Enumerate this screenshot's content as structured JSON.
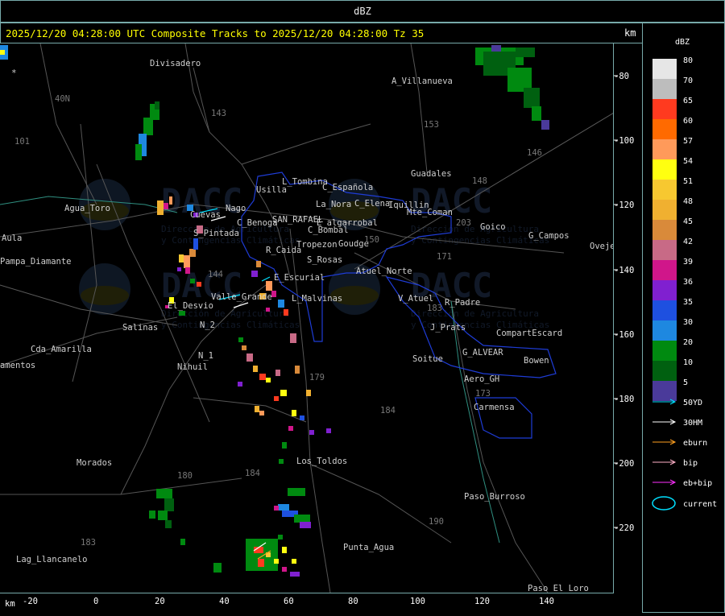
{
  "window": {
    "title": "dBZ"
  },
  "header": {
    "title": "2025/12/20 04:28:00 UTC Composite Tracks to 2025/12/20 04:28:00 Tz 35",
    "unit": "km"
  },
  "legend": {
    "title": "dBZ",
    "colors": [
      {
        "label": "80",
        "color": "#e6e6e6"
      },
      {
        "label": "70",
        "color": "#bdbdbd"
      },
      {
        "label": "65",
        "color": "#ff3a1f"
      },
      {
        "label": "60",
        "color": "#ff6a00"
      },
      {
        "label": "57",
        "color": "#ff9a5a"
      },
      {
        "label": "54",
        "color": "#ffff10"
      },
      {
        "label": "51",
        "color": "#f7c830"
      },
      {
        "label": "48",
        "color": "#f0b030"
      },
      {
        "label": "45",
        "color": "#d98a3a"
      },
      {
        "label": "42",
        "color": "#c86a86"
      },
      {
        "label": "39",
        "color": "#d0168a"
      },
      {
        "label": "36",
        "color": "#8020d0"
      },
      {
        "label": "35",
        "color": "#1e50e0"
      },
      {
        "label": "30",
        "color": "#1e88e0"
      },
      {
        "label": "20",
        "color": "#008a10"
      },
      {
        "label": "10",
        "color": "#006010"
      },
      {
        "label": "5",
        "color": "#4a3a9a"
      }
    ],
    "tracks": [
      {
        "label": "50YD",
        "color": "#00e0ff"
      },
      {
        "label": "30HM",
        "color": "#ffffff"
      },
      {
        "label": "eburn",
        "color": "#ffa020"
      },
      {
        "label": "bip",
        "color": "#ffb0c8"
      },
      {
        "label": "eb+bip",
        "color": "#ff30ff"
      }
    ],
    "current_label": "current",
    "current_color": "#00e0ff"
  },
  "axes": {
    "y_unit": "km",
    "y_ticks": [
      "-80",
      "-100",
      "-120",
      "-140",
      "-160",
      "-180",
      "-200",
      "-220"
    ],
    "x_unit": "km",
    "x_ticks": [
      "-20",
      "0",
      "20",
      "40",
      "60",
      "80",
      "100",
      "120",
      "140"
    ]
  },
  "places": [
    "Divisadero",
    "A_Villanueva",
    "Guadales",
    "Agua_Toro",
    "Aula",
    "Pampa_Diamante",
    "Usilla",
    "L_Tombina",
    "C_Española",
    "La_Nora",
    "C_Elena",
    "Iquillin",
    "Mte_Coman",
    "Goico",
    "G_Campos",
    "Oveje",
    "SAN_RAFAEL",
    "C_Benoga",
    "E_algarrobal",
    "C_Bombal",
    "Tropezon",
    "Goudge",
    "R_Caida",
    "S_Rosas",
    "Atuel_Norte",
    "E_Escurial",
    "V_Atuel",
    "R_Padre",
    "El_Desvio",
    "Valle_Grande",
    "L_Malvinas",
    "Salinas",
    "N_2",
    "N_1",
    "Nihuil",
    "J_Prats",
    "CompartEscard",
    "Cda_Amarilla",
    "amentos",
    "Soitue",
    "G_ALVEAR",
    "Bowen",
    "Aero_GH",
    "Carmensa",
    "Los_Toldos",
    "Morados",
    "Paso_Burroso",
    "Punta_Agua",
    "Lag_Llancanelo",
    "Paso_El_Loro",
    "S_Pintada",
    "Cuevas",
    "Nago"
  ],
  "routes": [
    "143",
    "153",
    "146",
    "148",
    "203",
    "171",
    "183",
    "173",
    "184",
    "180",
    "179",
    "190",
    "183",
    "40N",
    "101",
    "144",
    "150",
    "184"
  ],
  "watermark": {
    "text": "DACC",
    "line1": "Dirección de Agricultura",
    "line2": "y Contingencias Climáticas"
  }
}
